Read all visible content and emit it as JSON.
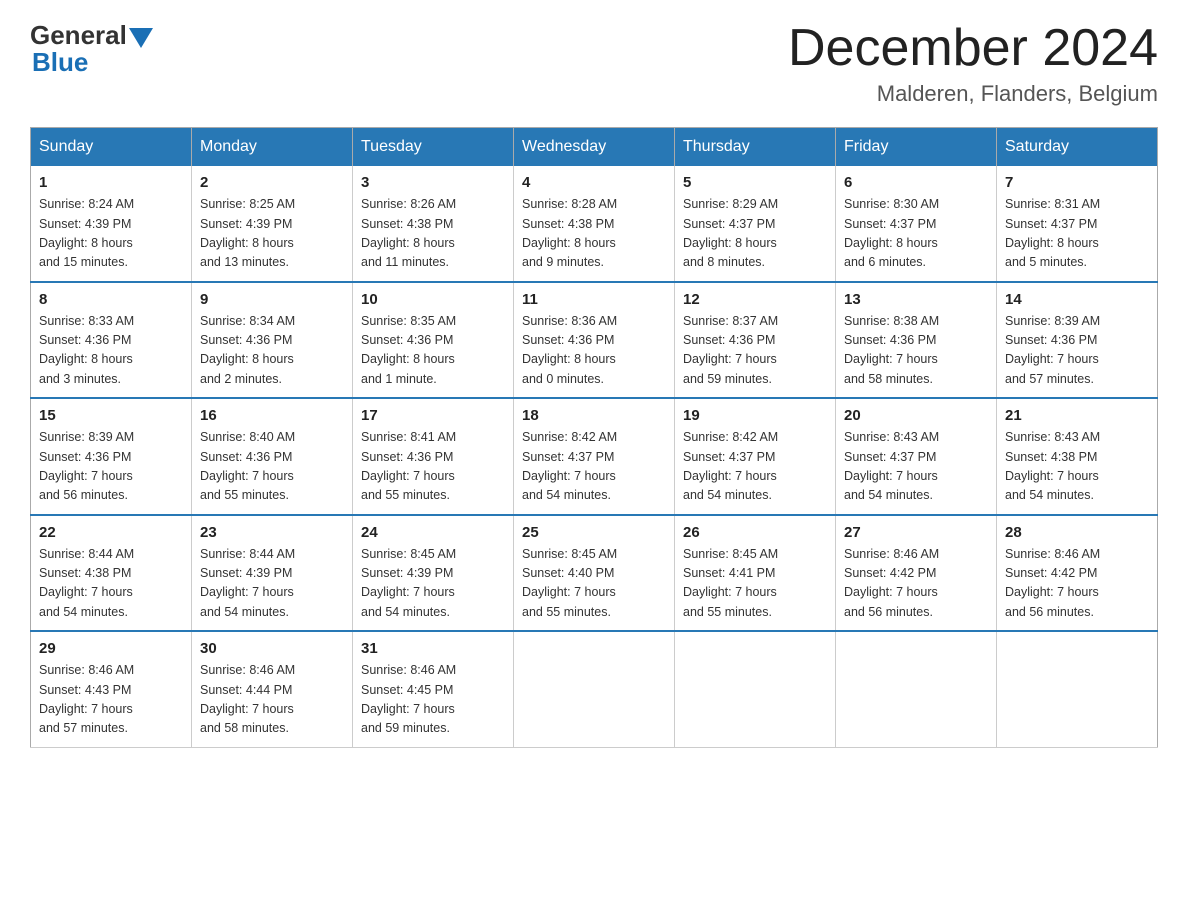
{
  "logo": {
    "general": "General",
    "blue": "Blue"
  },
  "header": {
    "month_year": "December 2024",
    "location": "Malderen, Flanders, Belgium"
  },
  "days_of_week": [
    "Sunday",
    "Monday",
    "Tuesday",
    "Wednesday",
    "Thursday",
    "Friday",
    "Saturday"
  ],
  "weeks": [
    [
      {
        "day": "1",
        "info": "Sunrise: 8:24 AM\nSunset: 4:39 PM\nDaylight: 8 hours\nand 15 minutes."
      },
      {
        "day": "2",
        "info": "Sunrise: 8:25 AM\nSunset: 4:39 PM\nDaylight: 8 hours\nand 13 minutes."
      },
      {
        "day": "3",
        "info": "Sunrise: 8:26 AM\nSunset: 4:38 PM\nDaylight: 8 hours\nand 11 minutes."
      },
      {
        "day": "4",
        "info": "Sunrise: 8:28 AM\nSunset: 4:38 PM\nDaylight: 8 hours\nand 9 minutes."
      },
      {
        "day": "5",
        "info": "Sunrise: 8:29 AM\nSunset: 4:37 PM\nDaylight: 8 hours\nand 8 minutes."
      },
      {
        "day": "6",
        "info": "Sunrise: 8:30 AM\nSunset: 4:37 PM\nDaylight: 8 hours\nand 6 minutes."
      },
      {
        "day": "7",
        "info": "Sunrise: 8:31 AM\nSunset: 4:37 PM\nDaylight: 8 hours\nand 5 minutes."
      }
    ],
    [
      {
        "day": "8",
        "info": "Sunrise: 8:33 AM\nSunset: 4:36 PM\nDaylight: 8 hours\nand 3 minutes."
      },
      {
        "day": "9",
        "info": "Sunrise: 8:34 AM\nSunset: 4:36 PM\nDaylight: 8 hours\nand 2 minutes."
      },
      {
        "day": "10",
        "info": "Sunrise: 8:35 AM\nSunset: 4:36 PM\nDaylight: 8 hours\nand 1 minute."
      },
      {
        "day": "11",
        "info": "Sunrise: 8:36 AM\nSunset: 4:36 PM\nDaylight: 8 hours\nand 0 minutes."
      },
      {
        "day": "12",
        "info": "Sunrise: 8:37 AM\nSunset: 4:36 PM\nDaylight: 7 hours\nand 59 minutes."
      },
      {
        "day": "13",
        "info": "Sunrise: 8:38 AM\nSunset: 4:36 PM\nDaylight: 7 hours\nand 58 minutes."
      },
      {
        "day": "14",
        "info": "Sunrise: 8:39 AM\nSunset: 4:36 PM\nDaylight: 7 hours\nand 57 minutes."
      }
    ],
    [
      {
        "day": "15",
        "info": "Sunrise: 8:39 AM\nSunset: 4:36 PM\nDaylight: 7 hours\nand 56 minutes."
      },
      {
        "day": "16",
        "info": "Sunrise: 8:40 AM\nSunset: 4:36 PM\nDaylight: 7 hours\nand 55 minutes."
      },
      {
        "day": "17",
        "info": "Sunrise: 8:41 AM\nSunset: 4:36 PM\nDaylight: 7 hours\nand 55 minutes."
      },
      {
        "day": "18",
        "info": "Sunrise: 8:42 AM\nSunset: 4:37 PM\nDaylight: 7 hours\nand 54 minutes."
      },
      {
        "day": "19",
        "info": "Sunrise: 8:42 AM\nSunset: 4:37 PM\nDaylight: 7 hours\nand 54 minutes."
      },
      {
        "day": "20",
        "info": "Sunrise: 8:43 AM\nSunset: 4:37 PM\nDaylight: 7 hours\nand 54 minutes."
      },
      {
        "day": "21",
        "info": "Sunrise: 8:43 AM\nSunset: 4:38 PM\nDaylight: 7 hours\nand 54 minutes."
      }
    ],
    [
      {
        "day": "22",
        "info": "Sunrise: 8:44 AM\nSunset: 4:38 PM\nDaylight: 7 hours\nand 54 minutes."
      },
      {
        "day": "23",
        "info": "Sunrise: 8:44 AM\nSunset: 4:39 PM\nDaylight: 7 hours\nand 54 minutes."
      },
      {
        "day": "24",
        "info": "Sunrise: 8:45 AM\nSunset: 4:39 PM\nDaylight: 7 hours\nand 54 minutes."
      },
      {
        "day": "25",
        "info": "Sunrise: 8:45 AM\nSunset: 4:40 PM\nDaylight: 7 hours\nand 55 minutes."
      },
      {
        "day": "26",
        "info": "Sunrise: 8:45 AM\nSunset: 4:41 PM\nDaylight: 7 hours\nand 55 minutes."
      },
      {
        "day": "27",
        "info": "Sunrise: 8:46 AM\nSunset: 4:42 PM\nDaylight: 7 hours\nand 56 minutes."
      },
      {
        "day": "28",
        "info": "Sunrise: 8:46 AM\nSunset: 4:42 PM\nDaylight: 7 hours\nand 56 minutes."
      }
    ],
    [
      {
        "day": "29",
        "info": "Sunrise: 8:46 AM\nSunset: 4:43 PM\nDaylight: 7 hours\nand 57 minutes."
      },
      {
        "day": "30",
        "info": "Sunrise: 8:46 AM\nSunset: 4:44 PM\nDaylight: 7 hours\nand 58 minutes."
      },
      {
        "day": "31",
        "info": "Sunrise: 8:46 AM\nSunset: 4:45 PM\nDaylight: 7 hours\nand 59 minutes."
      },
      null,
      null,
      null,
      null
    ]
  ]
}
